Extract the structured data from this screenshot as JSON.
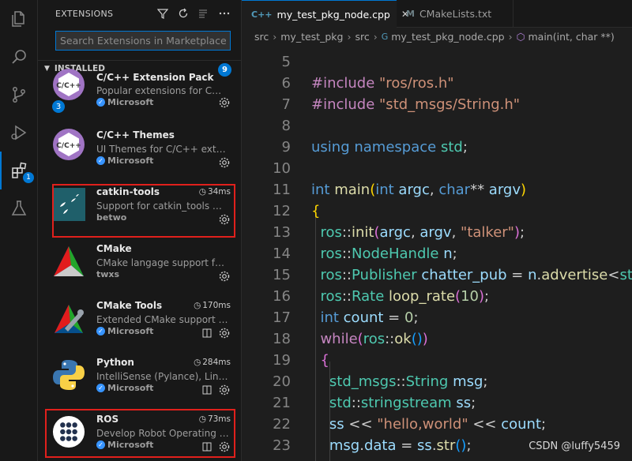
{
  "activity_bar": {
    "items": [
      {
        "icon": "files-icon"
      },
      {
        "icon": "search-icon"
      },
      {
        "icon": "source-control-icon"
      },
      {
        "icon": "run-debug-icon"
      },
      {
        "icon": "extensions-icon",
        "badge": "1"
      },
      {
        "icon": "flask-icon"
      }
    ]
  },
  "sidebar": {
    "title": "EXTENSIONS",
    "search_placeholder": "Search Extensions in Marketplace",
    "section_label": "INSTALLED",
    "section_count": "9",
    "extensions": [
      {
        "name": "C/C++ Extension Pack",
        "desc": "Popular extensions for C++ development",
        "publisher": "Microsoft",
        "verified": true,
        "badge": "3",
        "time": ""
      },
      {
        "name": "C/C++ Themes",
        "desc": "UI Themes for C/C++ extension",
        "publisher": "Microsoft",
        "verified": true,
        "time": ""
      },
      {
        "name": "catkin-tools",
        "desc": "Support for catkin_tools workspaces",
        "publisher": "betwo",
        "verified": false,
        "time": "34ms"
      },
      {
        "name": "CMake",
        "desc": "CMake langage support for Visual Studio Code",
        "publisher": "twxs",
        "verified": false,
        "time": ""
      },
      {
        "name": "CMake Tools",
        "desc": "Extended CMake support in Visual Studio Code",
        "publisher": "Microsoft",
        "verified": true,
        "time": "170ms"
      },
      {
        "name": "Python",
        "desc": "IntelliSense (Pylance), Linting, Debugging",
        "publisher": "Microsoft",
        "verified": true,
        "time": "284ms"
      },
      {
        "name": "ROS",
        "desc": "Develop Robot Operating System (ROS)",
        "publisher": "Microsoft",
        "verified": true,
        "time": "73ms"
      }
    ]
  },
  "editor": {
    "tabs": [
      {
        "label": "my_test_pkg_node.cpp",
        "icon": "C++",
        "active": true
      },
      {
        "label": "CMakeLists.txt",
        "icon": "M",
        "active": false
      }
    ],
    "breadcrumb": [
      "src",
      "my_test_pkg",
      "src",
      "my_test_pkg_node.cpp",
      "main(int, char **)"
    ],
    "line_numbers": [
      "5",
      "6",
      "7",
      "8",
      "9",
      "10",
      "11",
      "12",
      "13",
      "14",
      "15",
      "16",
      "17",
      "18",
      "19",
      "20",
      "21",
      "22",
      "23"
    ]
  },
  "watermark": "CSDN @luffy5459",
  "colors": {
    "accent": "#0078d4",
    "highlight_box": "#e0201c",
    "background": "#1e1e1e",
    "sidebar": "#181818"
  }
}
